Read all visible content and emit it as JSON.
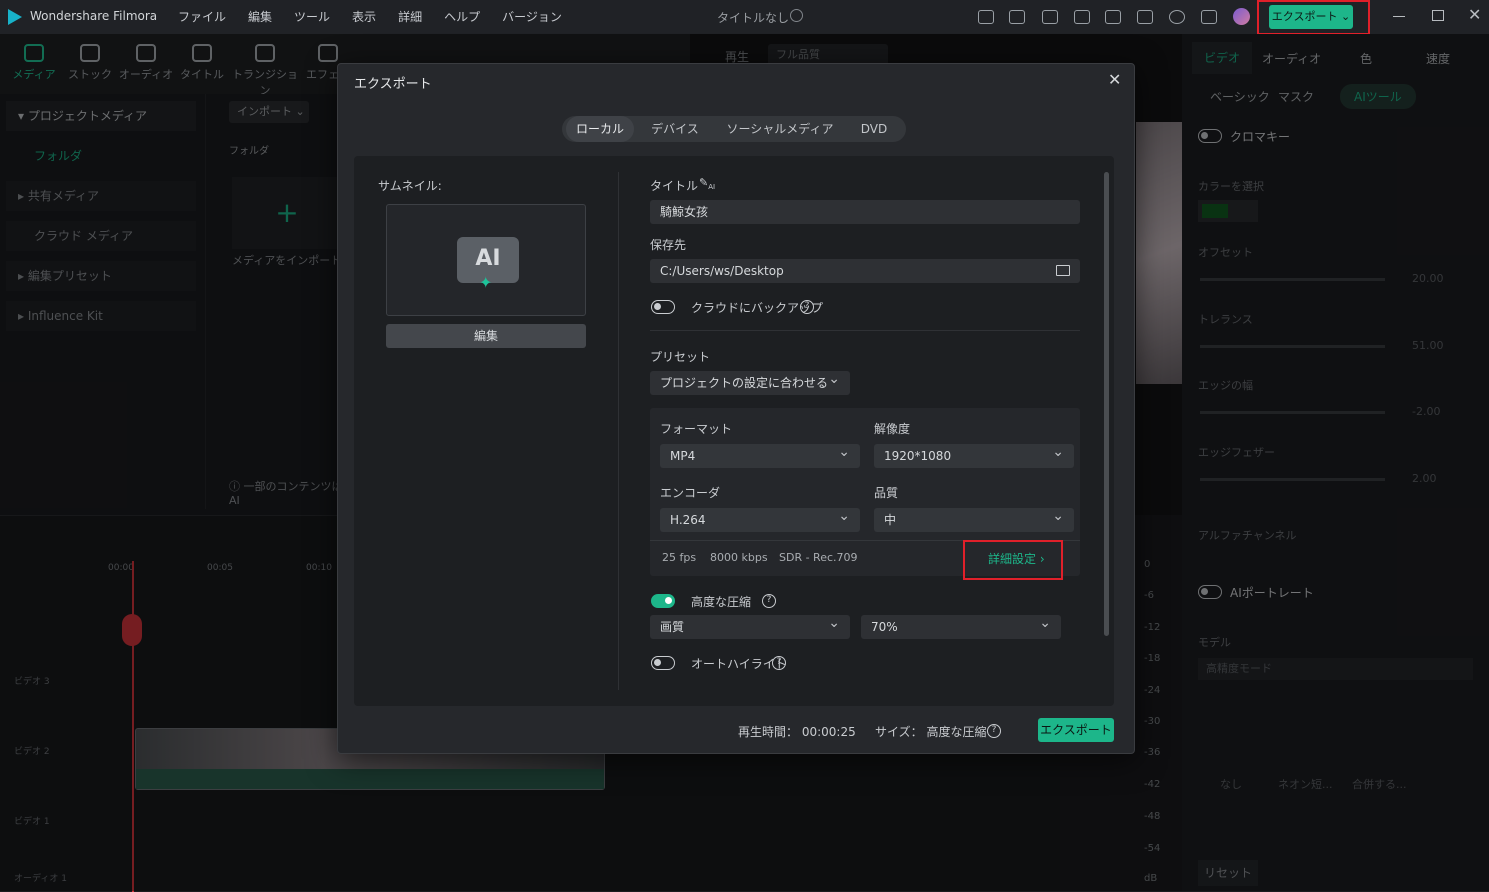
{
  "app": {
    "name": "Wondershare Filmora",
    "project_title": "タイトルなし",
    "export_top_label": "エクスポート"
  },
  "menu": [
    "ファイル",
    "編集",
    "ツール",
    "表示",
    "詳細",
    "ヘルプ",
    "バージョン"
  ],
  "toolbar": [
    "メディア",
    "ストック",
    "オーディオ",
    "タイトル",
    "トランジション",
    "エフェク"
  ],
  "left_panel": [
    "プロジェクトメディア",
    "フォルダ",
    "共有メディア",
    "クラウド メディア",
    "編集プリセット",
    "Influence Kit"
  ],
  "media": {
    "import_label": "インポート",
    "folder_label": "フォルダ",
    "import_media": "メディアをインポート",
    "notice": "一部のコンテンツはAI"
  },
  "preview": {
    "play_label": "再生",
    "quality": "フル品質"
  },
  "right_panel": {
    "tabs": [
      "ビデオ",
      "オーディオ",
      "色",
      "速度"
    ],
    "subtabs": [
      "ベーシック",
      "マスク",
      "AIツール"
    ],
    "chroma_key": "クロマキー",
    "color_select": "カラーを選択",
    "offset": "オフセット",
    "offset_val": "20.00",
    "tolerance": "トレランス",
    "tolerance_val": "51.00",
    "edge_thickness": "エッジの幅",
    "edge_thickness_val": "-2.00",
    "edge_feather": "エッジフェザー",
    "edge_feather_val": "2.00",
    "alpha": "アルファチャンネル",
    "ai_portrait": "AIポートレート",
    "model": "モデル",
    "model_val": "高精度モード",
    "none_label": "なし",
    "neon_label": "ネオン短...",
    "combine_label": "合併する...",
    "reset": "リセット"
  },
  "timeline": {
    "tracks": [
      "ビデオ 3",
      "ビデオ 2",
      "ビデオ 1",
      "オーディオ 1"
    ],
    "times": [
      "00:00",
      "00:05",
      "00:10"
    ],
    "db_scale": [
      "0",
      "-6",
      "-12",
      "-18",
      "-24",
      "-30",
      "-36",
      "-42",
      "-48",
      "-54",
      "dB"
    ]
  },
  "dialog": {
    "title": "エクスポート",
    "tabs": [
      "ローカル",
      "デバイス",
      "ソーシャルメディア",
      "DVD"
    ],
    "thumbnail_label": "サムネイル:",
    "edit_button": "編集",
    "title_label": "タイトル",
    "title_value": "騎鯨女孩",
    "save_label": "保存先",
    "save_value": "C:/Users/ws/Desktop",
    "cloud_backup": "クラウドにバックアップ",
    "preset_label": "プリセット",
    "preset_value": "プロジェクトの設定に合わせる",
    "format_label": "フォーマット",
    "format_value": "MP4",
    "resolution_label": "解像度",
    "resolution_value": "1920*1080",
    "encoder_label": "エンコーダ",
    "encoder_value": "H.264",
    "quality_label": "品質",
    "quality_value": "中",
    "fps": "25 fps",
    "bitrate": "8000 kbps",
    "hdr": "SDR - Rec.709",
    "advanced_button": "詳細設定",
    "advanced_compress": "高度な圧縮",
    "compress_mode": "画質",
    "compress_level": "70%",
    "auto_highlight": "オートハイライト",
    "duration_label": "再生時間：",
    "duration_value": "00:00:25",
    "size_label": "サイズ：",
    "size_value": "高度な圧縮",
    "export_button": "エクスポート"
  },
  "colors": {
    "accent": "#1db68a",
    "highlight_box": "#e0202a"
  }
}
